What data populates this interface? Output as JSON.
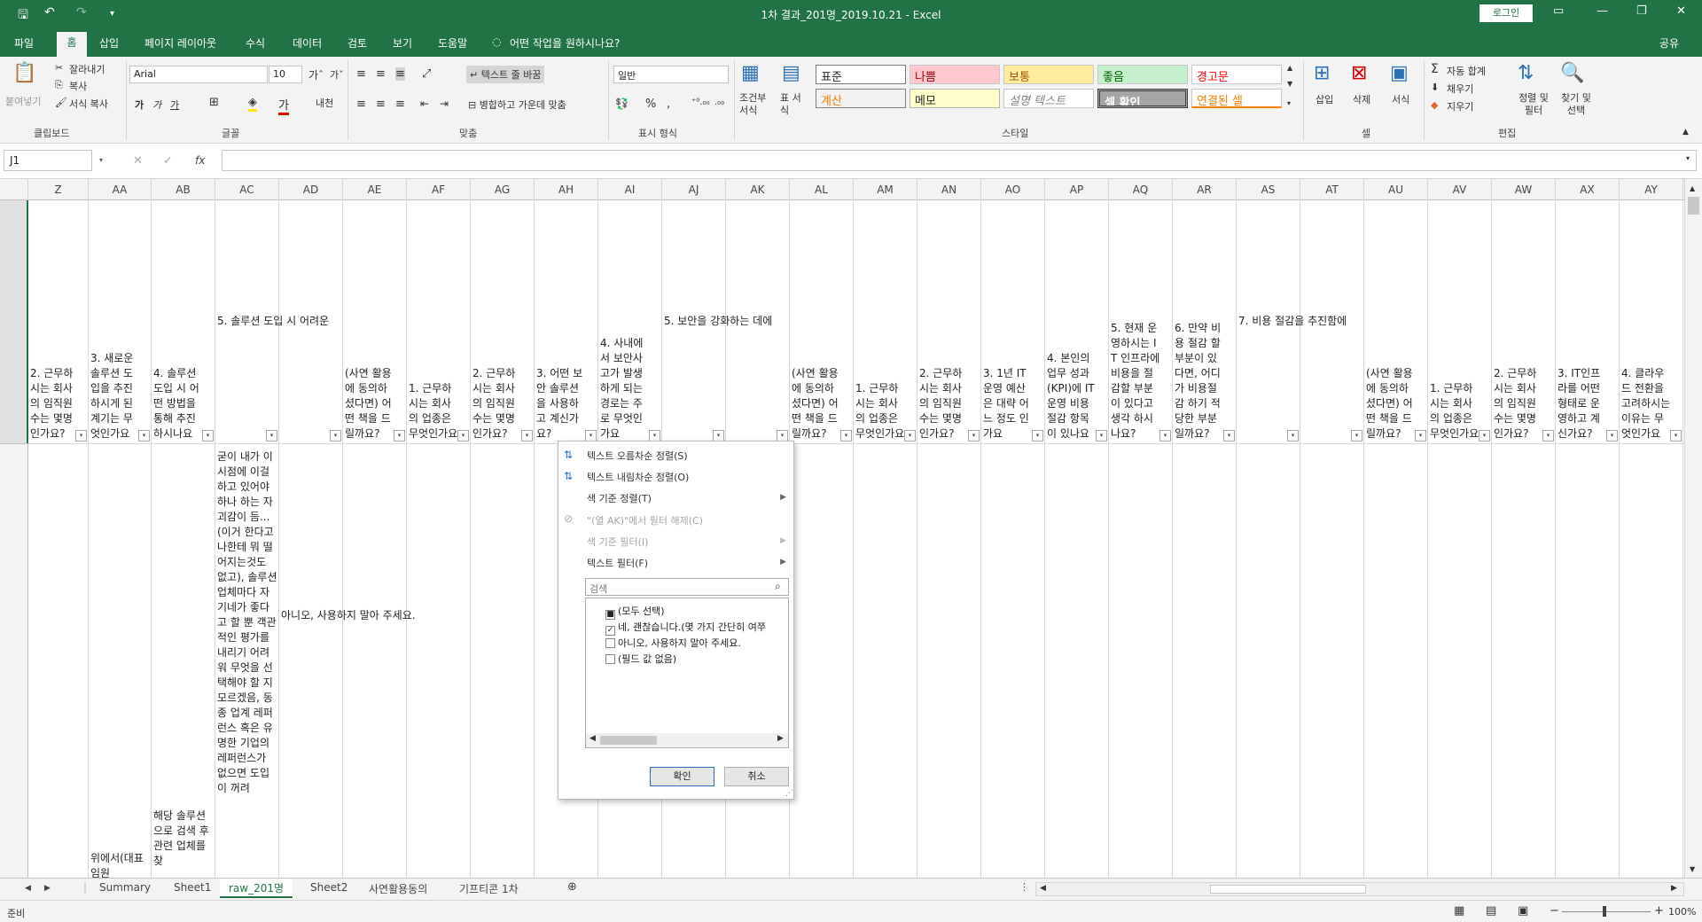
{
  "titlebar": {
    "title": "1차 결과_201명_2019.10.21  -  Excel",
    "login": "로그인",
    "undo": "↶",
    "redo": "↷",
    "save": "🖫"
  },
  "menu": {
    "file": "파일",
    "home": "홈",
    "insert": "삽입",
    "layout": "페이지 레이아웃",
    "formulas": "수식",
    "data": "데이터",
    "review": "검토",
    "view": "보기",
    "help": "도움말",
    "tellme": "어떤 작업을 원하시나요?",
    "share": "공유"
  },
  "ribbon": {
    "clipboard": {
      "paste": "붙여넣기",
      "cut": "잘라내기",
      "copy": "복사",
      "format_painter": "서식 복사",
      "label": "클립보드"
    },
    "font": {
      "name": "Arial",
      "size": "10",
      "label": "글꼴"
    },
    "align": {
      "wrap": "텍스트 줄 바꿈",
      "merge": "병합하고 가운데 맞춤",
      "label": "맞춤"
    },
    "number": {
      "format": "일반",
      "label": "표시 형식"
    },
    "styles": {
      "cond": "조건부 서식",
      "table": "표 서식",
      "label": "스타일",
      "cells": [
        "표준",
        "나쁨",
        "보통",
        "좋음",
        "경고문",
        "계산",
        "메모",
        "설명 텍스트",
        "셀 확인",
        "연결된 셀"
      ]
    },
    "cells": {
      "insert": "삽입",
      "delete": "삭제",
      "format": "서식",
      "label": "셀"
    },
    "editing": {
      "autosum": "자동 합계",
      "fill": "채우기",
      "clear": "지우기",
      "sort": "정렬 및 필터",
      "find": "찾기 및 선택",
      "label": "편집"
    }
  },
  "formula": {
    "namebox": "J1",
    "cancel": "✕",
    "enter": "✓",
    "fx": "fx",
    "content": ""
  },
  "columns": [
    "Z",
    "AA",
    "AB",
    "AC",
    "AD",
    "AE",
    "AF",
    "AG",
    "AH",
    "AI",
    "AJ",
    "AK",
    "AL",
    "AM",
    "AN",
    "AO",
    "AP",
    "AQ",
    "AR",
    "AS",
    "AT",
    "AU",
    "AV",
    "AW",
    "AX",
    "AY"
  ],
  "row1": [
    "2. 근무하시는 회사의 임직원수는 몇명인가요?",
    "3. 새로운 솔루션 도입을 추진하시게 된 계기는 무엇인가요",
    "4. 솔루션 도입 시 어떤 방법을 통해 추진하시나요",
    "5. 솔루션 도입 시 어려운",
    "",
    "(사연 활용에 동의하셨다면) 어떤 책을 드릴까요?",
    "1. 근무하시는 회사의 업종은 무엇인가요",
    "2. 근무하시는 회사의 임직원수는 몇명인가요?",
    "3. 어떤 보안 솔루션을 사용하고 계신가요?",
    "4. 사내에서 보안사고가 발생하게 되는 경로는 주로 무엇인가요",
    "5. 보안을 강화하는 데에",
    "",
    "(사연 활용에 동의하셨다면) 어떤 책을 드릴까요?",
    "1. 근무하시는 회사의 업종은 무엇인가요",
    "2. 근무하시는 회사의 임직원수는 몇명인가요?",
    "3. 1년 IT운영 예산은 대략 어느 정도 인가요",
    "4. 본인의 업무 성과(KPI)에 IT 운영 비용 절감 항목이 있나요",
    "5. 현재 운영하시는 IT 인프라에 비용을 절감할 부분이 있다고 생각 하시나요?",
    "6. 만약 비용 절감 할 부분이 있다면, 어디가 비용절감 하기 적당한 부분일까요?",
    "7. 비용 절감을 추진함에",
    "",
    "(사연 활용에 동의하셨다면) 어떤 책을 드릴까요?",
    "1. 근무하시는 회사의 업종은 무엇인가요",
    "2. 근무하시는 회사의 임직원수는 몇명인가요?",
    "3. IT인프라를 어떤 형태로 운영하고 계신가요?",
    "4. 클라우드 전환을 고려하시는 이유는 무엇인가요"
  ],
  "row2": {
    "aa": "위에서(대표 임원",
    "ab": "해당 솔루션으로 검색 후 관련 업체를 찾",
    "ac": "굳이 내가 이 시점에 이걸 하고 있어야 하나 하는 자괴감이 듬...(이거 한다고 나한테 뭐 떨어지는것도 없고), 솔루션 업체마다 자기네가 좋다고 할 뿐 객관적인 평가를 내리기 어려워 무엇을 선택해야 할 지 모르겠음, 동종 업계 레퍼런스 혹은 유명한 기업의 레퍼런스가 없으면 도입이 꺼려",
    "ad": "아니오, 사용하지 말아 주세요."
  },
  "filter": {
    "sort_asc": "텍스트 오름차순 정렬(S)",
    "sort_desc": "텍스트 내림차순 정렬(O)",
    "sort_color": "색 기준 정렬(T)",
    "clear": "\"(열 AK)\"에서 필터 해제(C)",
    "filter_color": "색 기준 필터(I)",
    "text_filter": "텍스트 필터(F)",
    "search": "검색",
    "items": [
      "(모두 선택)",
      "네, 괜찮습니다.(몇 가지 간단히 여쭈",
      "아니오, 사용하지 말아 주세요.",
      "(필드 값 없음)"
    ],
    "ok": "확인",
    "cancel": "취소"
  },
  "sheets": [
    "Summary",
    "Sheet1",
    "raw_201명",
    "Sheet2",
    "사연활용동의",
    "기프티콘 1차"
  ],
  "status": {
    "ready": "준비",
    "zoom": "100%"
  }
}
